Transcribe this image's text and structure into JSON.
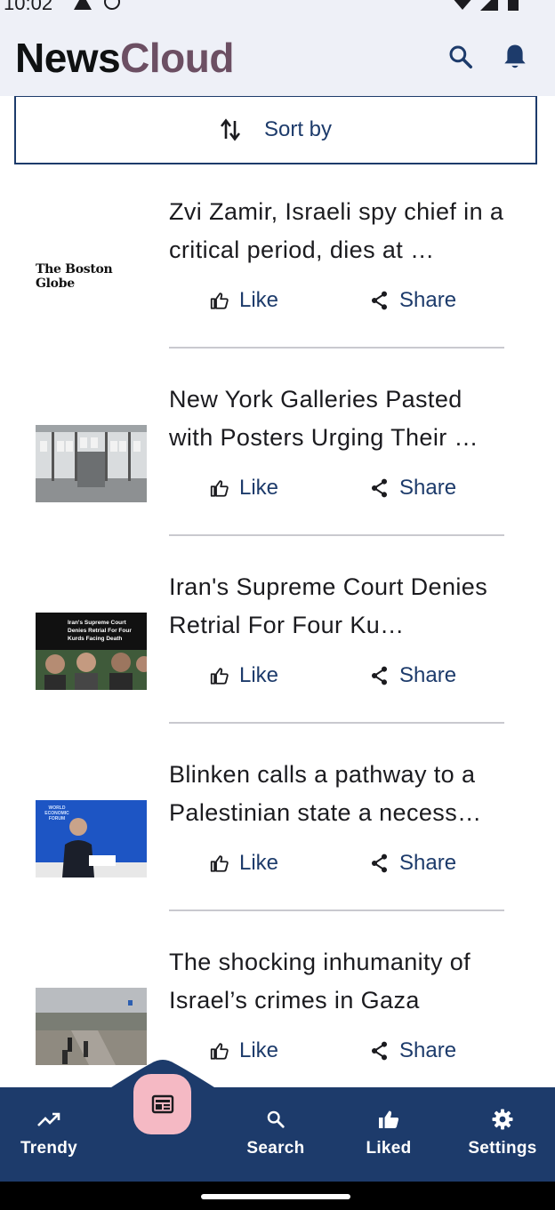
{
  "status_bar": {
    "time": "10:02"
  },
  "app_bar": {
    "title_part1": "News",
    "title_part2": "Cloud",
    "search_icon": "search-icon",
    "notifications_icon": "bell-icon"
  },
  "sort": {
    "label": "Sort by",
    "icon": "swap-vertical-icon"
  },
  "articles": [
    {
      "title": "Zvi Zamir, Israeli spy chief in a critical period, dies at …",
      "source_logo": "The Boston Globe",
      "like": "Like",
      "share": "Share"
    },
    {
      "title": "New York Galleries Pasted with Posters Urging Their …",
      "like": "Like",
      "share": "Share"
    },
    {
      "title": "Iran's Supreme Court Denies Retrial For Four Ku…",
      "thumb_text": "Iran's Supreme Court Denies Retrial For Four Kurds Facing Death Sentences",
      "like": "Like",
      "share": "Share"
    },
    {
      "title": "Blinken calls a pathway to a Palestinian state a necess…",
      "thumb_text": "WORLD ECONOMIC FORUM",
      "like": "Like",
      "share": "Share"
    },
    {
      "title": "The shocking inhumanity of Israel’s crimes in Gaza",
      "like": "Like",
      "share": "Share"
    }
  ],
  "bottom_nav": {
    "items": [
      {
        "label": "Trendy",
        "icon": "trending-up-icon"
      },
      {
        "label": "",
        "icon": "newspaper-icon",
        "selected": true
      },
      {
        "label": "Search",
        "icon": "search-icon"
      },
      {
        "label": "Liked",
        "icon": "thumb-up-icon"
      },
      {
        "label": "Settings",
        "icon": "gear-icon"
      }
    ]
  },
  "colors": {
    "primary": "#1d3b6b",
    "app_bar_bg": "#eef0f7",
    "accent_brand": "#6c4f63",
    "fab_bg": "#f5b9c4"
  }
}
